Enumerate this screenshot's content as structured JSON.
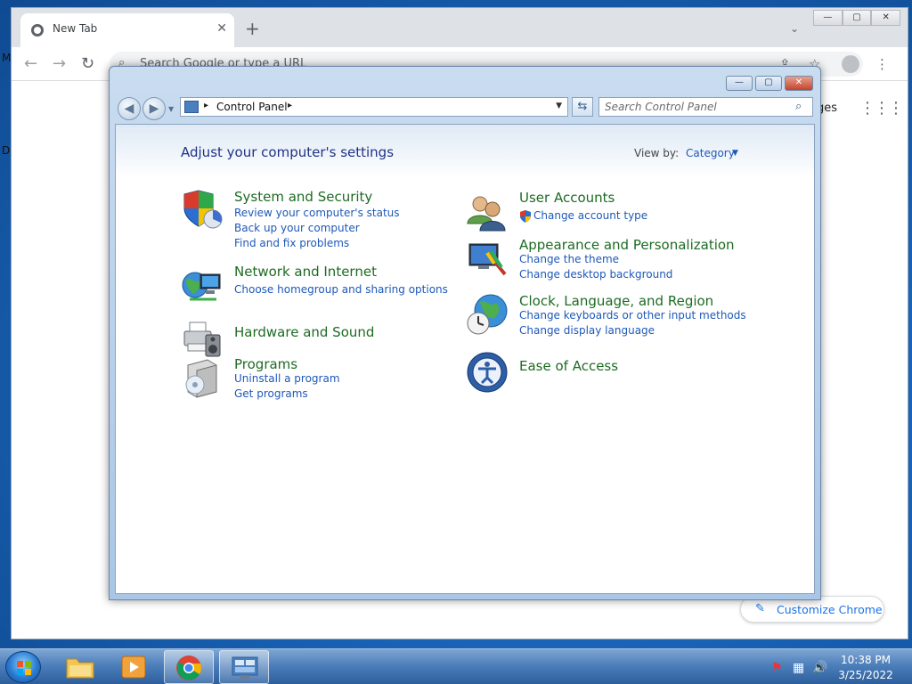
{
  "desktop": {
    "left_letter_top": "M",
    "left_letter_mid": "D"
  },
  "chrome": {
    "tab_title": "New Tab",
    "tab_close": "✕",
    "new_tab": "+",
    "tab_search": "⌄",
    "win_min": "—",
    "win_max": "▢",
    "win_close": "✕",
    "back": "←",
    "forward": "→",
    "reload": "↻",
    "omnibox_placeholder": "Search Google or type a URL",
    "omnibox_icon": "⌕",
    "share": "⇪",
    "star": "☆",
    "menu": "⋮",
    "ntp_images": "ges",
    "ntp_apps": "⋮⋮⋮",
    "customize_icon": "✎",
    "customize_label": "Customize Chrome"
  },
  "control_panel": {
    "win_min": "—",
    "win_max": "▢",
    "win_close": "✕",
    "back": "◀",
    "forward": "▶",
    "nav_drop": "▼",
    "address_sep": "▸",
    "address": "Control Panel",
    "address_drop": "▼",
    "refresh": "⇆",
    "search_placeholder": "Search Control Panel",
    "search_icon": "⌕",
    "heading": "Adjust your computer's settings",
    "view_by_label": "View by:",
    "view_by_value": "Category",
    "view_by_caret": "▼",
    "categories": [
      {
        "title": "System and Security",
        "links": [
          "Review your computer's status",
          "Back up your computer",
          "Find and fix problems"
        ]
      },
      {
        "title": "Network and Internet",
        "links": [
          "Choose homegroup and sharing options"
        ]
      },
      {
        "title": "Hardware and Sound",
        "links": []
      },
      {
        "title": "Programs",
        "links": [
          "Uninstall a program",
          "Get programs"
        ]
      },
      {
        "title": "User Accounts",
        "links": [
          "Change account type"
        ]
      },
      {
        "title": "Appearance and Personalization",
        "links": [
          "Change the theme",
          "Change desktop background"
        ]
      },
      {
        "title": "Clock, Language, and Region",
        "links": [
          "Change keyboards or other input methods",
          "Change display language"
        ]
      },
      {
        "title": "Ease of Access",
        "links": []
      }
    ]
  },
  "taskbar": {
    "tray_flag": "⚑",
    "tray_network": "▦",
    "tray_volume": "🔊",
    "clock_time": "10:38 PM",
    "clock_date": "3/25/2022"
  },
  "colors": {
    "link": "#1e58b9",
    "category_title": "#1d6b23",
    "heading": "#1e3287"
  }
}
